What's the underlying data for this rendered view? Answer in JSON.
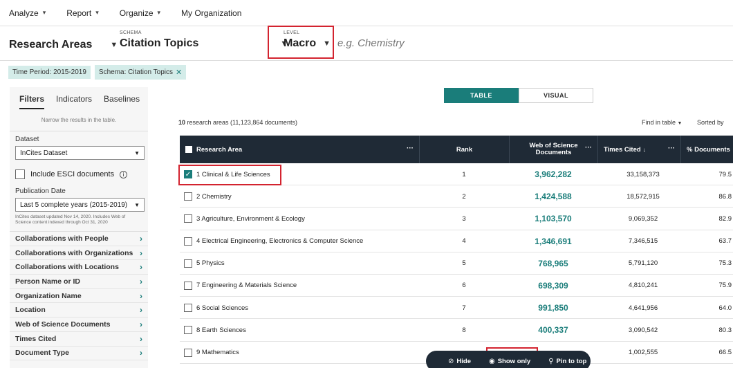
{
  "menu": [
    {
      "label": "Analyze",
      "caret": true
    },
    {
      "label": "Report",
      "caret": true
    },
    {
      "label": "Organize",
      "caret": true
    },
    {
      "label": "My Organization",
      "caret": false
    }
  ],
  "schema_row": {
    "research_areas": "Research Areas",
    "schema_label": "SCHEMA",
    "schema_value": "Citation Topics",
    "level_label": "LEVEL",
    "level_value": "Macro",
    "search_placeholder": "e.g. Chemistry"
  },
  "chips": [
    {
      "label": "Time Period: 2015-2019",
      "removable": false
    },
    {
      "label": "Schema: Citation Topics",
      "removable": true
    }
  ],
  "left_panel": {
    "tabs": [
      "Filters",
      "Indicators",
      "Baselines"
    ],
    "active_tab": "Filters",
    "narrow_text": "Narrow the results in the table.",
    "dataset_label": "Dataset",
    "dataset_value": "InCites Dataset",
    "esci_label": "Include ESCI documents",
    "pub_date_label": "Publication Date",
    "pub_date_value": "Last 5 complete years (2015-2019)",
    "note": "InCites dataset updated Nov 14, 2020. Includes Web of Science content indexed through Oct 31, 2020",
    "filters": [
      "Collaborations with People",
      "Collaborations with Organizations",
      "Collaborations with Locations",
      "Person Name or ID",
      "Organization Name",
      "Location",
      "Web of Science Documents",
      "Times Cited",
      "Document Type"
    ]
  },
  "view_toggle": {
    "table": "TABLE",
    "visual": "VISUAL",
    "active": "TABLE"
  },
  "results": {
    "count_bold": "10",
    "count_rest": " research areas (11,123,864 documents)",
    "find_in_table": "Find in table",
    "sorted_by": "Sorted by"
  },
  "table": {
    "headers": {
      "research_area": "Research Area",
      "rank": "Rank",
      "wos_docs": "Web of Science Documents",
      "times_cited": "Times Cited",
      "pct_docs": "% Documents"
    },
    "more_icon": "···",
    "sort_icon": "↓",
    "rows": [
      {
        "checked": true,
        "area": "1 Clinical & Life Sciences",
        "rank": "1",
        "wos": "3,962,282",
        "cited": "33,158,373",
        "pct": "79.5"
      },
      {
        "checked": false,
        "area": "2 Chemistry",
        "rank": "2",
        "wos": "1,424,588",
        "cited": "18,572,915",
        "pct": "86.8"
      },
      {
        "checked": false,
        "area": "3 Agriculture, Environment & Ecology",
        "rank": "3",
        "wos": "1,103,570",
        "cited": "9,069,352",
        "pct": "82.9"
      },
      {
        "checked": false,
        "area": "4 Electrical Engineering, Electronics & Computer Science",
        "rank": "4",
        "wos": "1,346,691",
        "cited": "7,346,515",
        "pct": "63.7"
      },
      {
        "checked": false,
        "area": "5 Physics",
        "rank": "5",
        "wos": "768,965",
        "cited": "5,791,120",
        "pct": "75.3"
      },
      {
        "checked": false,
        "area": "7 Engineering & Materials Science",
        "rank": "6",
        "wos": "698,309",
        "cited": "4,810,241",
        "pct": "75.9"
      },
      {
        "checked": false,
        "area": "6 Social Sciences",
        "rank": "7",
        "wos": "991,850",
        "cited": "4,641,956",
        "pct": "64.0"
      },
      {
        "checked": false,
        "area": "8 Earth Sciences",
        "rank": "8",
        "wos": "400,337",
        "cited": "3,090,542",
        "pct": "80.3"
      },
      {
        "checked": false,
        "area": "9 Mathematics",
        "rank": "",
        "wos": "",
        "cited": "1,002,555",
        "pct": "66.5"
      }
    ]
  },
  "action_bar": {
    "hide": "Hide",
    "show_only": "Show only",
    "pin": "Pin to top"
  },
  "colors": {
    "accent": "#1a7d7a",
    "dark": "#1f2a36",
    "highlight": "#d3232f",
    "chip": "#d4ece9"
  }
}
